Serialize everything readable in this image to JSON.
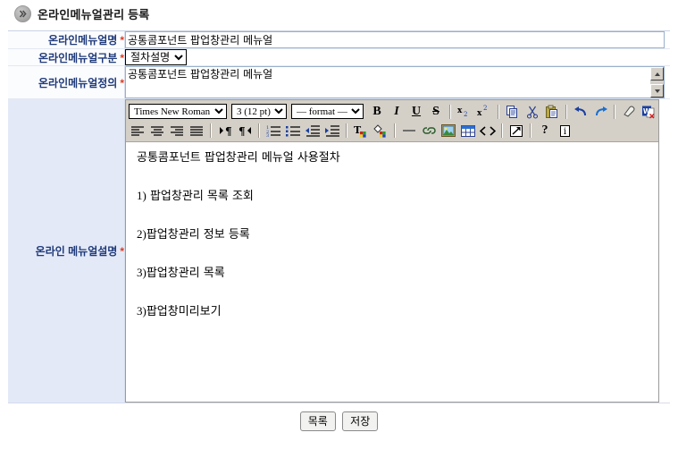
{
  "header": {
    "icon": "chevron-bullet-icon",
    "title": "온라인메뉴얼관리 등록"
  },
  "form": {
    "required_mark": "*",
    "rows": [
      {
        "label": "온라인메뉴얼명",
        "value": "공통콤포넌트 팝업창관리 메뉴얼"
      },
      {
        "label": "온라인메뉴얼구분",
        "selected": "절차설명",
        "options": [
          "절차설명"
        ]
      },
      {
        "label": "온라인메뉴얼정의",
        "value": "공통콤포넌트 팝업창관리 메뉴얼"
      },
      {
        "label": "온라인 메뉴얼설명"
      }
    ]
  },
  "editor": {
    "font_select": {
      "value": "Times New Roman",
      "options": [
        "Times New Roman"
      ]
    },
    "size_select": {
      "value": "3 (12 pt)",
      "options": [
        "3 (12 pt)"
      ]
    },
    "format_select": {
      "value": "— format —",
      "options": [
        "— format —"
      ]
    },
    "toolbar_row1": [
      {
        "name": "bold-icon",
        "glyph": "B"
      },
      {
        "name": "italic-icon",
        "glyph": "I"
      },
      {
        "name": "underline-icon",
        "glyph": "U"
      },
      {
        "name": "strikethrough-icon",
        "glyph": "S"
      },
      {
        "name": "subscript-icon",
        "glyph": "x₂"
      },
      {
        "name": "superscript-icon",
        "glyph": "x²"
      },
      {
        "name": "copy-icon",
        "glyph": ""
      },
      {
        "name": "cut-icon",
        "glyph": ""
      },
      {
        "name": "paste-icon",
        "glyph": ""
      },
      {
        "name": "undo-icon",
        "glyph": ""
      },
      {
        "name": "redo-icon",
        "glyph": ""
      },
      {
        "name": "eraser-icon",
        "glyph": ""
      },
      {
        "name": "clean-word-html-icon",
        "glyph": ""
      }
    ],
    "toolbar_row2": [
      {
        "name": "align-left-icon"
      },
      {
        "name": "align-center-icon"
      },
      {
        "name": "align-right-icon"
      },
      {
        "name": "align-justify-icon"
      },
      {
        "name": "direction-ltr-icon"
      },
      {
        "name": "direction-rtl-icon"
      },
      {
        "name": "ordered-list-icon"
      },
      {
        "name": "unordered-list-icon"
      },
      {
        "name": "outdent-icon"
      },
      {
        "name": "indent-icon"
      },
      {
        "name": "text-color-icon"
      },
      {
        "name": "background-color-icon"
      },
      {
        "name": "horizontal-rule-icon"
      },
      {
        "name": "link-icon"
      },
      {
        "name": "image-icon"
      },
      {
        "name": "table-icon"
      },
      {
        "name": "source-code-icon"
      },
      {
        "name": "fullscreen-icon"
      },
      {
        "name": "help-icon"
      },
      {
        "name": "info-icon"
      }
    ],
    "content": [
      {
        "num": "",
        "text": "공통콤포넌트 팝업창관리 메뉴얼 사용절차"
      },
      {
        "num": "1)",
        "text": " 팝업창관리 목록 조회"
      },
      {
        "num": "2)",
        "text": "팝업창관리 정보 등록"
      },
      {
        "num": "3)",
        "text": "팝업창관리 목록"
      },
      {
        "num": "3)",
        "text": "팝업창미리보기"
      }
    ]
  },
  "footer": {
    "list_button": "목록",
    "save_button": "저장"
  },
  "colors": {
    "label_text": "#1f3a7a",
    "required": "#e03a1e",
    "label_cell_tall": "#e3e9f7",
    "toolbar": "#d4d0c8"
  }
}
